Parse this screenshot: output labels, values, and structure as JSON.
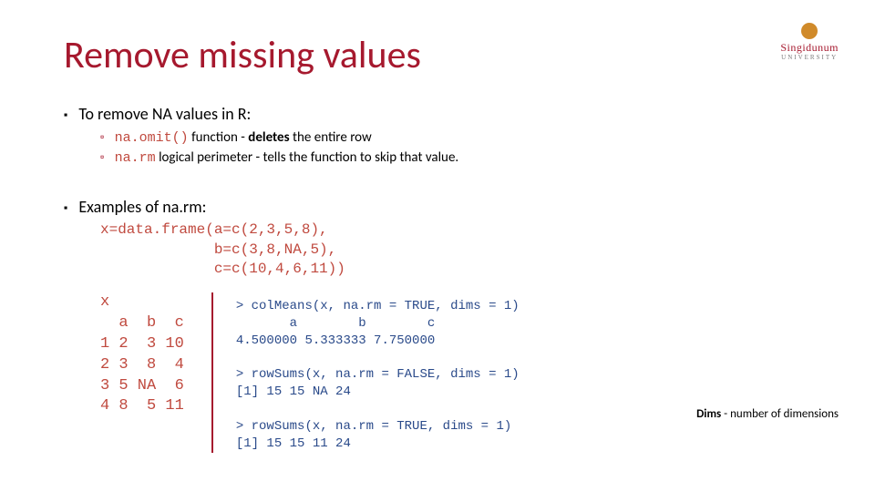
{
  "logo": {
    "brand": "Singidunum",
    "sub": "UNIVERSITY"
  },
  "title": "Remove missing values",
  "bullets": [
    {
      "text": "To remove NA values in R:",
      "subs": [
        {
          "code": "na.omit()",
          "pre": " function - ",
          "bold": "deletes",
          "post": " the entire row"
        },
        {
          "code": "na.rm",
          "post": " logical perimeter - tells the function to skip that value."
        }
      ]
    },
    {
      "text": "Examples of na.rm:"
    }
  ],
  "code_define": "x=data.frame(a=c(2,3,5,8),\n             b=c(3,8,NA,5),\n             c=c(10,4,6,11))",
  "code_x": "x\n  a  b  c\n1 2  3 10\n2 3  8  4\n3 5 NA  6\n4 8  5 11",
  "code_console": "> colMeans(x, na.rm = TRUE, dims = 1)\n       a        b        c\n4.500000 5.333333 7.750000\n\n> rowSums(x, na.rm = FALSE, dims = 1)\n[1] 15 15 NA 24\n\n> rowSums(x, na.rm = TRUE, dims = 1)\n[1] 15 15 11 24",
  "note": {
    "bold": "Dims",
    "rest": " - number of dimensions"
  }
}
